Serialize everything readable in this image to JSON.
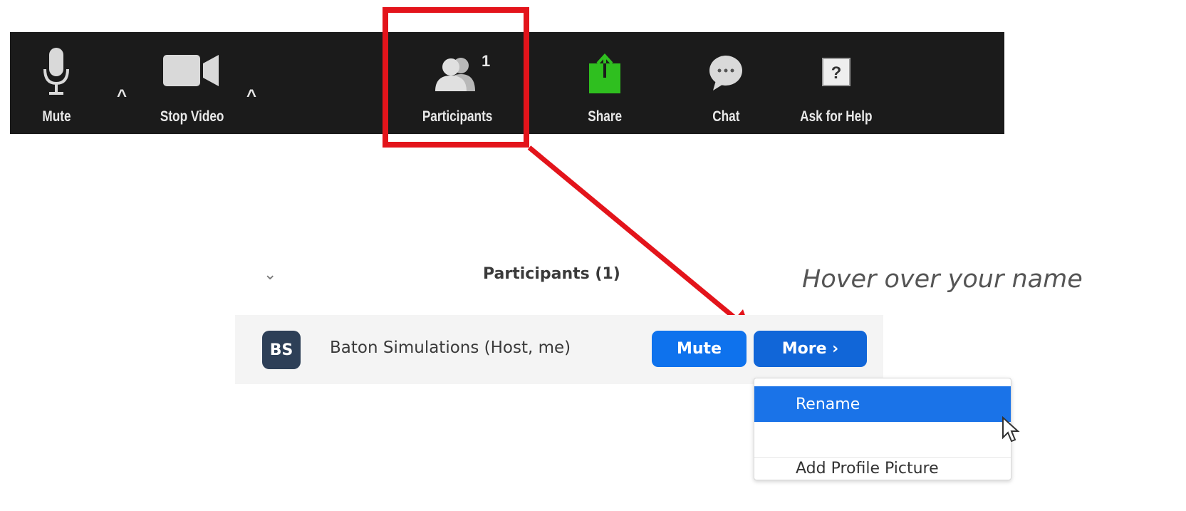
{
  "toolbar": {
    "mute_label": "Mute",
    "stop_video_label": "Stop Video",
    "participants_label": "Participants",
    "participants_count": "1",
    "share_label": "Share",
    "chat_label": "Chat",
    "help_label": "Ask for Help",
    "caret": "^",
    "help_icon_glyph": "?",
    "chat_icon_glyph": "···"
  },
  "panel": {
    "collapse_glyph": "⌄",
    "title": "Participants (1)",
    "participant": {
      "initials": "BS",
      "name": "Baton Simulations (Host, me)",
      "mute_button": "Mute",
      "more_button": "More ›"
    }
  },
  "menu": {
    "items": [
      {
        "label": "Rename"
      },
      {
        "label": "Add Profile Picture"
      }
    ]
  },
  "annotation": {
    "hint": "Hover over your name"
  },
  "colors": {
    "toolbar_bg": "#1b1b1b",
    "highlight": "#e3141b",
    "share_green": "#2fbf1f",
    "button_blue": "#0e72ed",
    "avatar_bg": "#2d3f57"
  }
}
